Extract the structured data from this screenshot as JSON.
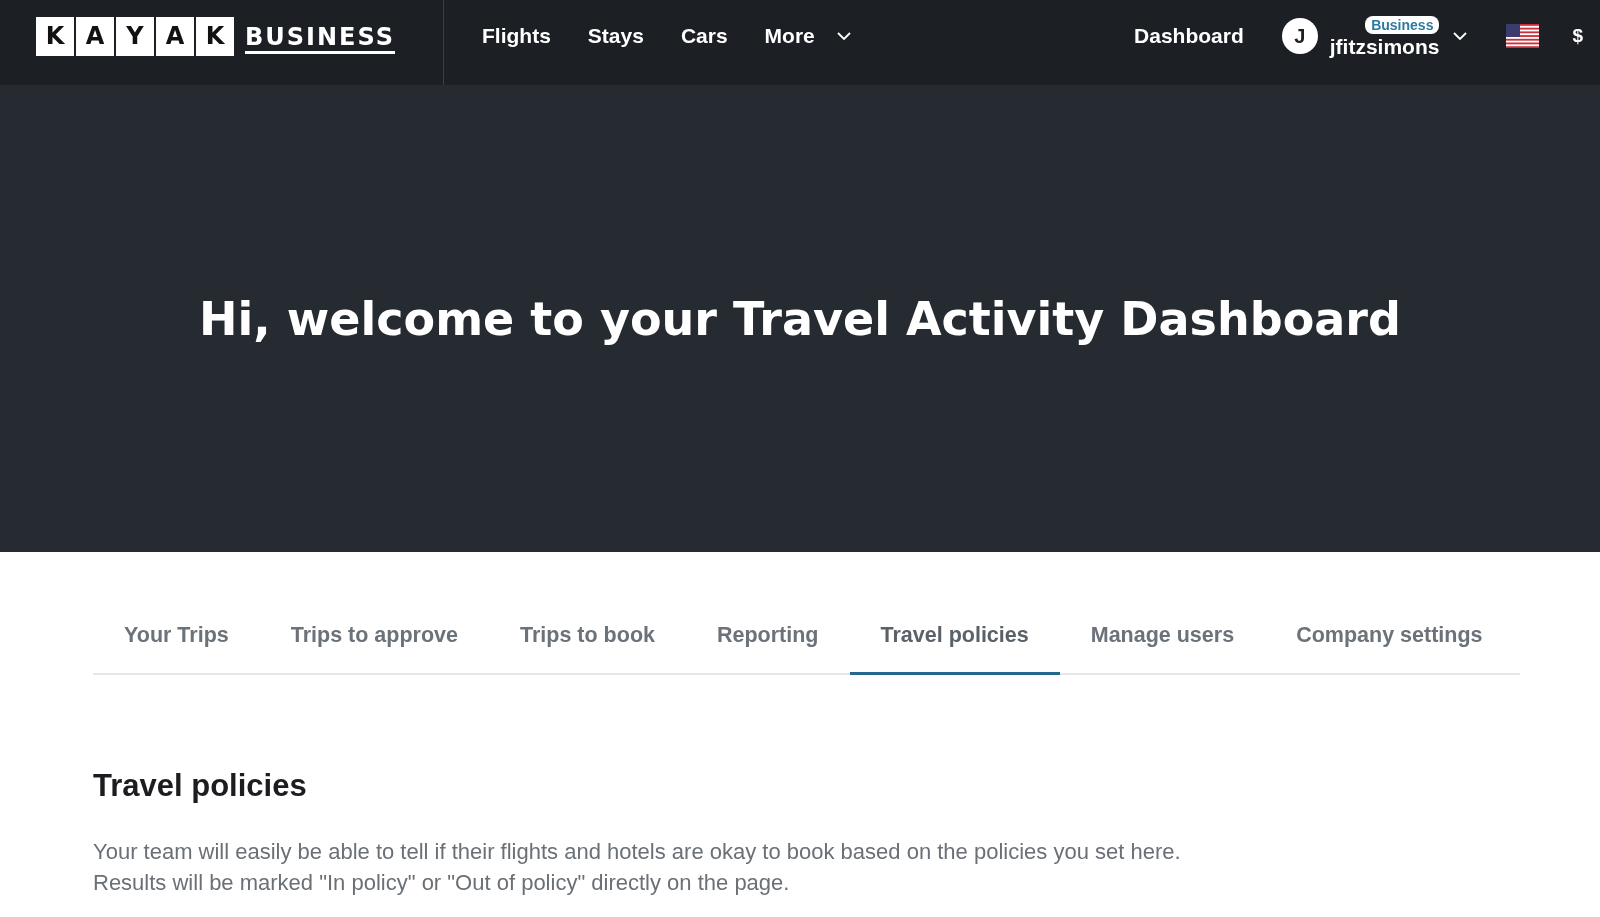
{
  "header": {
    "logo": {
      "letters": [
        "K",
        "A",
        "Y",
        "A",
        "K"
      ],
      "wordmark": "BUSINESS"
    },
    "nav": [
      {
        "label": "Flights",
        "has_menu": false
      },
      {
        "label": "Stays",
        "has_menu": false
      },
      {
        "label": "Cars",
        "has_menu": false
      },
      {
        "label": "More",
        "has_menu": true
      }
    ],
    "dashboard_link": "Dashboard",
    "user": {
      "initial": "J",
      "badge": "Business",
      "name": "jfitzsimons"
    },
    "currency": "$"
  },
  "hero": {
    "title": "Hi, welcome to your Travel Activity Dashboard"
  },
  "tabs": [
    {
      "label": "Your Trips",
      "selected": false
    },
    {
      "label": "Trips to approve",
      "selected": false
    },
    {
      "label": "Trips to book",
      "selected": false
    },
    {
      "label": "Reporting",
      "selected": false
    },
    {
      "label": "Travel policies",
      "selected": true
    },
    {
      "label": "Manage users",
      "selected": false
    },
    {
      "label": "Company settings",
      "selected": false
    }
  ],
  "section": {
    "title": "Travel policies",
    "description": [
      "Your team will easily be able to tell if their flights and hotels are okay to book based on the policies you set here.",
      "Results will be marked \"In policy\" or \"Out of policy\" directly on the page."
    ]
  }
}
